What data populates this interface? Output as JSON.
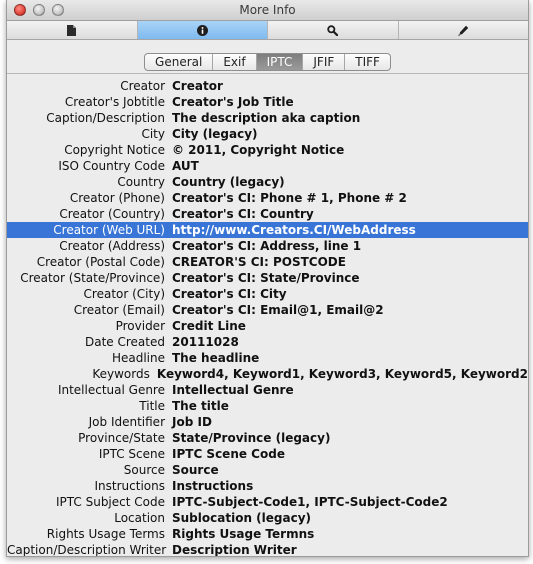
{
  "window": {
    "title": "More Info"
  },
  "toolbar": {
    "buttons": [
      {
        "icon": "document-icon",
        "active": false
      },
      {
        "icon": "info-icon",
        "active": true
      },
      {
        "icon": "search-icon",
        "active": false
      },
      {
        "icon": "pen-icon",
        "active": false
      }
    ]
  },
  "tabs": [
    "General",
    "Exif",
    "IPTC",
    "JFIF",
    "TIFF"
  ],
  "active_tab": "IPTC",
  "selection_color": "#3875d7",
  "fields": [
    {
      "label": "Creator",
      "value": "Creator"
    },
    {
      "label": "Creator's Jobtitle",
      "value": "Creator's Job Title"
    },
    {
      "label": "Caption/Description",
      "value": "The description aka caption"
    },
    {
      "label": "City",
      "value": "City (legacy)"
    },
    {
      "label": "Copyright Notice",
      "value": "© 2011, Copyright Notice"
    },
    {
      "label": "ISO Country Code",
      "value": "AUT"
    },
    {
      "label": "Country",
      "value": "Country (legacy)"
    },
    {
      "label": "Creator (Phone)",
      "value": "Creator's CI: Phone # 1, Phone # 2"
    },
    {
      "label": "Creator (Country)",
      "value": "Creator's CI: Country"
    },
    {
      "label": "Creator (Web URL)",
      "value": "http://www.Creators.CI/WebAddress",
      "selected": true
    },
    {
      "label": "Creator (Address)",
      "value": "Creator's CI: Address, line 1"
    },
    {
      "label": "Creator (Postal Code)",
      "value": "CREATOR'S CI: POSTCODE"
    },
    {
      "label": "Creator (State/Province)",
      "value": "Creator's CI: State/Province"
    },
    {
      "label": "Creator (City)",
      "value": "Creator's CI: City"
    },
    {
      "label": "Creator (Email)",
      "value": "Creator's CI: Email@1, Email@2"
    },
    {
      "label": "Provider",
      "value": "Credit Line"
    },
    {
      "label": "Date Created",
      "value": "20111028"
    },
    {
      "label": "Headline",
      "value": "The headline"
    },
    {
      "label": "Keywords",
      "value": "Keyword4, Keyword1, Keyword3, Keyword5, Keyword2"
    },
    {
      "label": "Intellectual Genre",
      "value": "Intellectual Genre"
    },
    {
      "label": "Title",
      "value": "The title"
    },
    {
      "label": "Job Identifier",
      "value": "Job ID"
    },
    {
      "label": "Province/State",
      "value": "State/Province (legacy)"
    },
    {
      "label": "IPTC Scene",
      "value": "IPTC Scene Code"
    },
    {
      "label": "Source",
      "value": "Source"
    },
    {
      "label": "Instructions",
      "value": "Instructions"
    },
    {
      "label": "IPTC Subject Code",
      "value": "IPTC-Subject-Code1, IPTC-Subject-Code2"
    },
    {
      "label": "Location",
      "value": "Sublocation (legacy)"
    },
    {
      "label": "Rights Usage Terms",
      "value": "Rights Usage Termns"
    },
    {
      "label": "Caption/Description Writer",
      "value": "Description Writer"
    }
  ]
}
